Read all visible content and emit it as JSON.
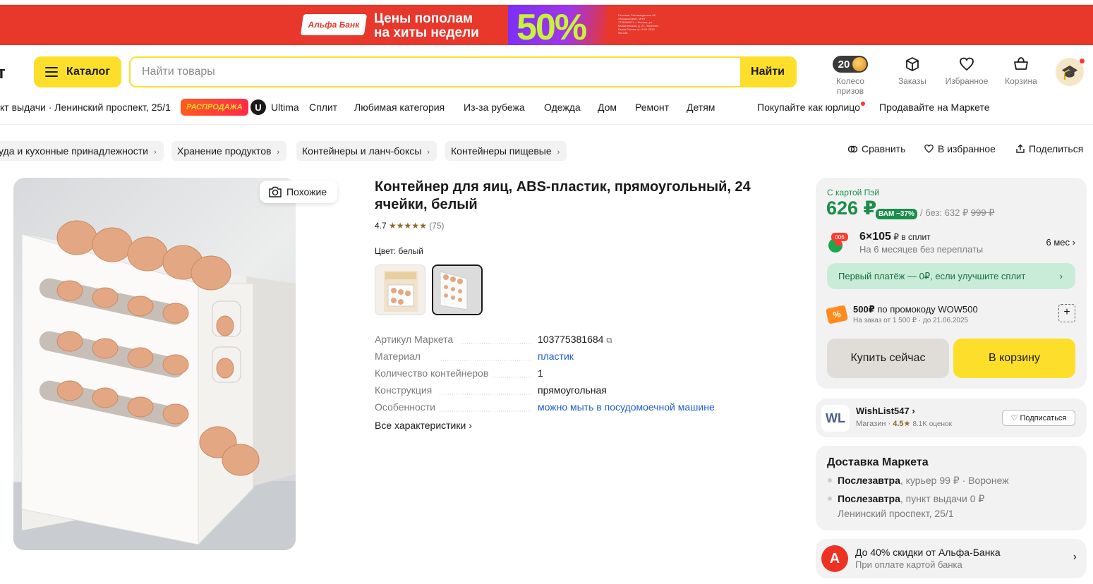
{
  "banner": {
    "bank": "Альфа Банк",
    "line1": "Цены пополам",
    "line2": "на хиты недели",
    "percent": "50%",
    "fine_print": "Реклама. Рекламодатель АО «Альфа-Банк», ИНН 7728168971, г. Москва, ул. Каланчевская, д. 27. Лицензия Банка России от 16.01.2015 №1326."
  },
  "header": {
    "logo_fragment": "т",
    "catalog_label": "Каталог",
    "search_placeholder": "Найти товары",
    "search_button": "Найти",
    "wheel_count": "20",
    "wheel_label": "Колесо призов",
    "orders_label": "Заказы",
    "favorites_label": "Избранное",
    "cart_label": "Корзина"
  },
  "nav": {
    "pickup": "кт выдачи · Ленинский проспект, 25/1",
    "sale": "РАСПРОДАЖА",
    "ultima_icon": "U",
    "items": [
      "Ultima",
      "Сплит",
      "Любимая категория",
      "Из-за рубежа",
      "Одежда",
      "Дом",
      "Ремонт",
      "Детям"
    ],
    "b2b": "Покупайте как юрлицо",
    "sell": "Продавайте на Маркете"
  },
  "breadcrumbs": [
    "уда и кухонные принадлежности",
    "Хранение продуктов",
    "Контейнеры и ланч-боксы",
    "Контейнеры пищевые"
  ],
  "actions": {
    "compare": "Сравнить",
    "favorite": "В избранное",
    "share": "Поделиться"
  },
  "product": {
    "similar": "Похожие",
    "title": "Контейнер для яиц, ABS-пластик, прямоугольный, 24 ячейки, белый",
    "rating": "4.7",
    "stars": "★★★★★",
    "reviews": "(75)",
    "color_label": "Цвет: белый",
    "specs": [
      {
        "k": "Артикул Маркета",
        "v": "103775381684"
      },
      {
        "k": "Материал",
        "v": "пластик"
      },
      {
        "k": "Количество контейнеров",
        "v": "1"
      },
      {
        "k": "Конструкция",
        "v": "прямоугольная"
      },
      {
        "k": "Особенности",
        "v": "можно мыть в посудомоечной машине"
      }
    ],
    "all_specs": "Все характеристики"
  },
  "buy": {
    "card_label": "С картой Пэй",
    "price": "626 ₽",
    "discount": "ВАМ −37%",
    "price_without_label": "/ без: 632 ₽",
    "old_price": "999 ₽",
    "split_main": "6×105",
    "split_main_suffix": " ₽ в сплит",
    "split_sub": "На 6 месяцев без переплаты",
    "split_term": "6 мес",
    "split_upgrade": "Первый платёж — 0₽, если улучшите сплит",
    "promo_amount": "500₽",
    "promo_text": " по промокоду WOW500",
    "promo_sub": "На заказ от 1 500 ₽ · до 21.06.2025",
    "buy_now": "Купить сейчас",
    "to_cart": "В корзину"
  },
  "shop": {
    "logo": "WL",
    "name": "WishList547",
    "meta_prefix": "Магазин · ",
    "rating": "4.5",
    "ratings_count": "8.1K оценок",
    "subscribe": "Подписаться"
  },
  "delivery": {
    "title": "Доставка Маркета",
    "line1_bold": "Послезавтра",
    "line1_rest": ", курьер 99 ₽ · Воронеж",
    "line2_bold": "Послезавтра",
    "line2_rest": ", пункт выдачи 0 ₽",
    "line2_addr": "Ленинский проспект, 25/1"
  },
  "alfa_promo": {
    "logo": "А",
    "main": "До 40% скидки от Альфа-Банка",
    "sub": "При оплате картой банка"
  },
  "colors": {
    "accent_yellow": "#fddf2b",
    "price_green": "#1a8f4a",
    "banner_red": "#e8372b",
    "link_blue": "#1e5bd6"
  }
}
